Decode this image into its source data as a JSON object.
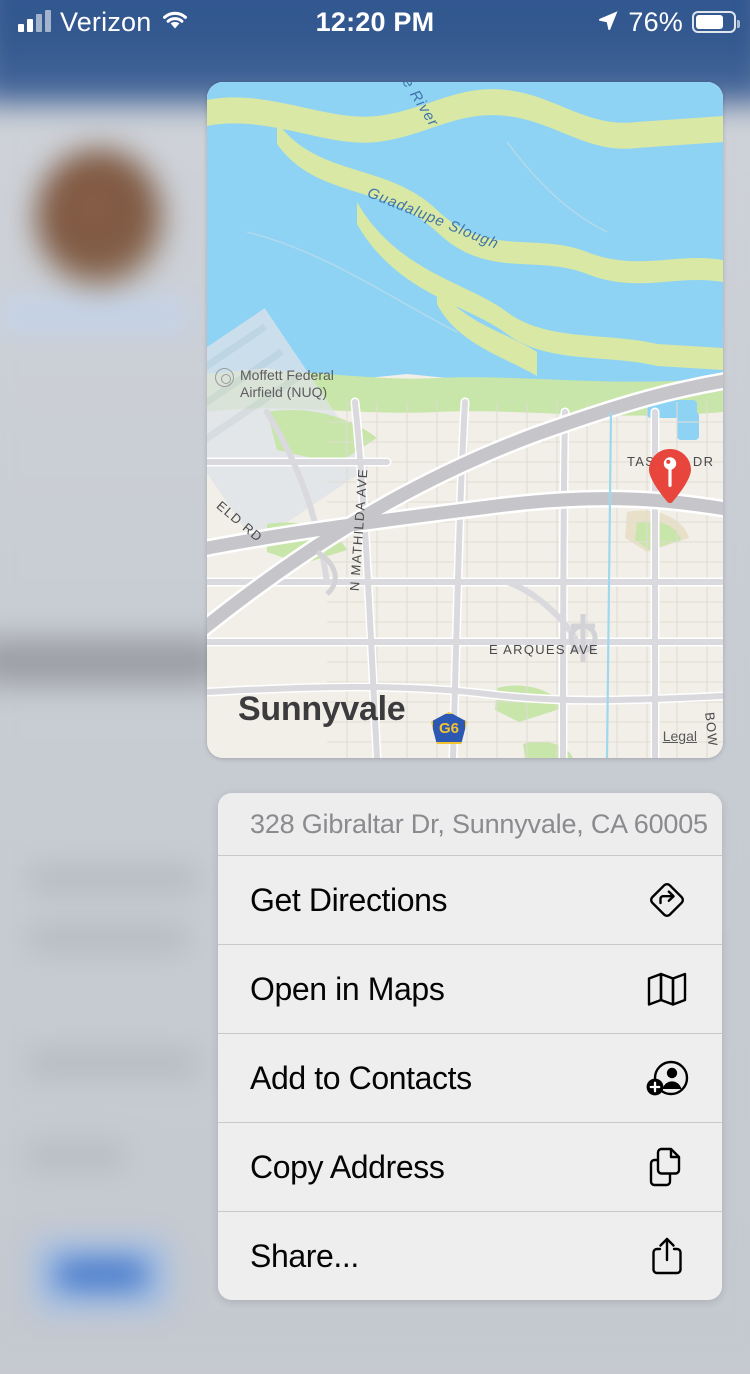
{
  "status_bar": {
    "carrier": "Verizon",
    "signal_icon": "cellular-bars-icon",
    "wifi_icon": "wifi-icon",
    "time": "12:20 PM",
    "location_icon": "location-arrow-icon",
    "battery_percent": "76%",
    "battery_icon": "battery-icon",
    "battery_level": 76,
    "text_color": "#ffffff",
    "background_color": "#34598f"
  },
  "map": {
    "pin_icon": "map-pin-icon",
    "pin_color": "#e8453c",
    "city_label": "Sunnyvale",
    "legal_link": "Legal",
    "water_color": "#8ed3f4",
    "marsh_color": "#d9e8a4",
    "land_color": "#f2efe9",
    "park_color": "#c8e6a9",
    "road_color": "#bdbdc0",
    "labels": [
      {
        "name": "guadalupe-river",
        "text": "e River"
      },
      {
        "name": "guadalupe-slough",
        "text": "Guadalupe Slough"
      },
      {
        "name": "tasman-dr",
        "text": "TASMAN DR"
      },
      {
        "name": "n-mathilda-ave",
        "text": "N MATHILDA AVE"
      },
      {
        "name": "e-arques-ave",
        "text": "E ARQUES AVE"
      },
      {
        "name": "moffett-field-rd",
        "text": "ELD RD"
      },
      {
        "name": "bowers-ave",
        "text": "BOW"
      }
    ],
    "poi": {
      "icon": "airport-icon",
      "line1": "Moffett Federal",
      "line2": "Airfield (NUQ)"
    },
    "highway_shield": {
      "label": "G6",
      "fill": "#2c57b2",
      "text_color": "#f2c230"
    }
  },
  "action_sheet": {
    "address": "328 Gibraltar Dr, Sunnyvale, CA 60005",
    "items": [
      {
        "label": "Get Directions",
        "icon": "directions-icon"
      },
      {
        "label": "Open in Maps",
        "icon": "folded-map-icon"
      },
      {
        "label": "Add to Contacts",
        "icon": "person-add-icon"
      },
      {
        "label": "Copy Address",
        "icon": "copy-documents-icon"
      },
      {
        "label": "Share...",
        "icon": "share-icon"
      }
    ]
  }
}
